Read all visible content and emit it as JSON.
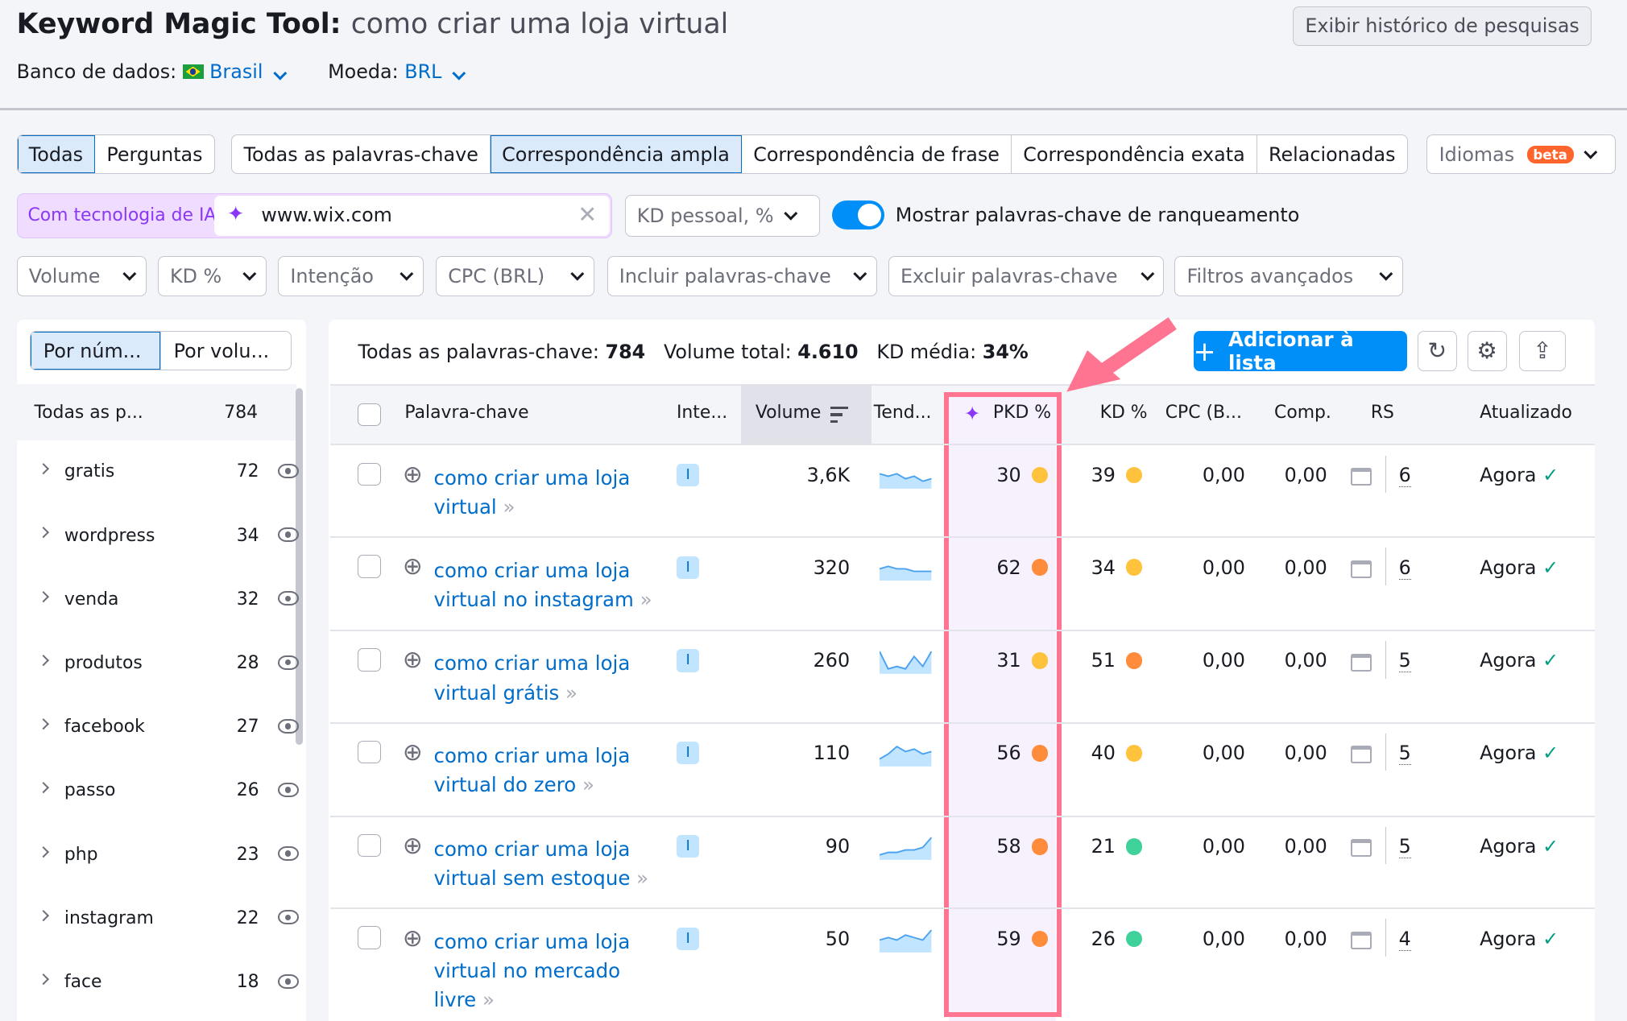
{
  "header": {
    "title": "Keyword Magic Tool:",
    "query": "como criar uma loja virtual",
    "history_button": "Exibir histórico de pesquisas",
    "db_label": "Banco de dados:",
    "db_value": "Brasil",
    "currency_label": "Moeda:",
    "currency_value": "BRL"
  },
  "tabs_a": [
    "Todas",
    "Perguntas"
  ],
  "tabs_b": [
    "Todas as palavras-chave",
    "Correspondência ampla",
    "Correspondência de frase",
    "Correspondência exata",
    "Relacionadas"
  ],
  "languages": {
    "label": "Idiomas",
    "badge": "beta"
  },
  "ai": {
    "label": "Com tecnologia de IA",
    "domain": "www.wix.com"
  },
  "kd_personal": "KD pessoal, %",
  "toggle": {
    "label": "Mostrar palavras-chave de ranqueamento",
    "on": true
  },
  "filters": [
    "Volume",
    "KD %",
    "Intenção",
    "CPC (BRL)",
    "Incluir palavras-chave",
    "Excluir palavras-chave",
    "Filtros avançados"
  ],
  "sidebar": {
    "tabs": [
      "Por núm...",
      "Por volu..."
    ],
    "all_label": "Todas as p...",
    "all_count": "784",
    "items": [
      {
        "label": "gratis",
        "count": "72"
      },
      {
        "label": "wordpress",
        "count": "34"
      },
      {
        "label": "venda",
        "count": "32"
      },
      {
        "label": "produtos",
        "count": "28"
      },
      {
        "label": "facebook",
        "count": "27"
      },
      {
        "label": "passo",
        "count": "26"
      },
      {
        "label": "php",
        "count": "23"
      },
      {
        "label": "instagram",
        "count": "22"
      },
      {
        "label": "face",
        "count": "18"
      }
    ]
  },
  "summary": {
    "all_label": "Todas as palavras-chave:",
    "all_value": "784",
    "vol_label": "Volume total:",
    "vol_value": "4.610",
    "kd_label": "KD média:",
    "kd_value": "34%"
  },
  "add_button": "Adicionar à lista",
  "columns": [
    "Palavra-chave",
    "Inte...",
    "Volume",
    "Tend...",
    "PKD %",
    "KD %",
    "CPC (B...",
    "Comp.",
    "RS",
    "Atualizado"
  ],
  "colors": {
    "accent": "#006dca",
    "highlight": "#ff7490",
    "orange": "#ff8c3a",
    "yellow": "#ffc23d",
    "green": "#3ed199"
  },
  "rows": [
    {
      "kw1": "como criar uma loja",
      "kw2": "virtual",
      "kw3": "",
      "intent": "I",
      "volume": "3,6K",
      "pkd": "30",
      "pkd_color": "#ffc23d",
      "kd": "39",
      "kd_color": "#ffc23d",
      "cpc": "0,00",
      "comp": "0,00",
      "rs": "6",
      "updated": "Agora",
      "trend": [
        6,
        5,
        6,
        4,
        5,
        3,
        4
      ]
    },
    {
      "kw1": "como criar uma loja",
      "kw2": "virtual no instagram",
      "kw3": "",
      "intent": "I",
      "volume": "320",
      "pkd": "62",
      "pkd_color": "#ff8c3a",
      "kd": "34",
      "kd_color": "#ffc23d",
      "cpc": "0,00",
      "comp": "0,00",
      "rs": "6",
      "updated": "Agora",
      "trend": [
        5,
        6,
        5,
        5,
        4,
        4,
        4
      ]
    },
    {
      "kw1": "como criar uma loja",
      "kw2": "virtual grátis",
      "kw3": "",
      "intent": "I",
      "volume": "260",
      "pkd": "31",
      "pkd_color": "#ffc23d",
      "kd": "51",
      "kd_color": "#ff8c3a",
      "cpc": "0,00",
      "comp": "0,00",
      "rs": "5",
      "updated": "Agora",
      "trend": [
        9,
        2,
        3,
        2,
        7,
        3,
        9
      ]
    },
    {
      "kw1": "como criar uma loja",
      "kw2": "virtual do zero",
      "kw3": "",
      "intent": "I",
      "volume": "110",
      "pkd": "56",
      "pkd_color": "#ff8c3a",
      "kd": "40",
      "kd_color": "#ffc23d",
      "cpc": "0,00",
      "comp": "0,00",
      "rs": "5",
      "updated": "Agora",
      "trend": [
        3,
        5,
        8,
        6,
        7,
        5,
        6
      ]
    },
    {
      "kw1": "como criar uma loja",
      "kw2": "virtual sem estoque",
      "kw3": "",
      "intent": "I",
      "volume": "90",
      "pkd": "58",
      "pkd_color": "#ff8c3a",
      "kd": "21",
      "kd_color": "#3ed199",
      "cpc": "0,00",
      "comp": "0,00",
      "rs": "5",
      "updated": "Agora",
      "trend": [
        2,
        3,
        3,
        4,
        4,
        5,
        9
      ]
    },
    {
      "kw1": "como criar uma loja",
      "kw2": "virtual no mercado",
      "kw3": "livre",
      "intent": "I",
      "volume": "50",
      "pkd": "59",
      "pkd_color": "#ff8c3a",
      "kd": "26",
      "kd_color": "#3ed199",
      "cpc": "0,00",
      "comp": "0,00",
      "rs": "4",
      "updated": "Agora",
      "trend": [
        5,
        6,
        5,
        7,
        6,
        5,
        9
      ]
    }
  ]
}
